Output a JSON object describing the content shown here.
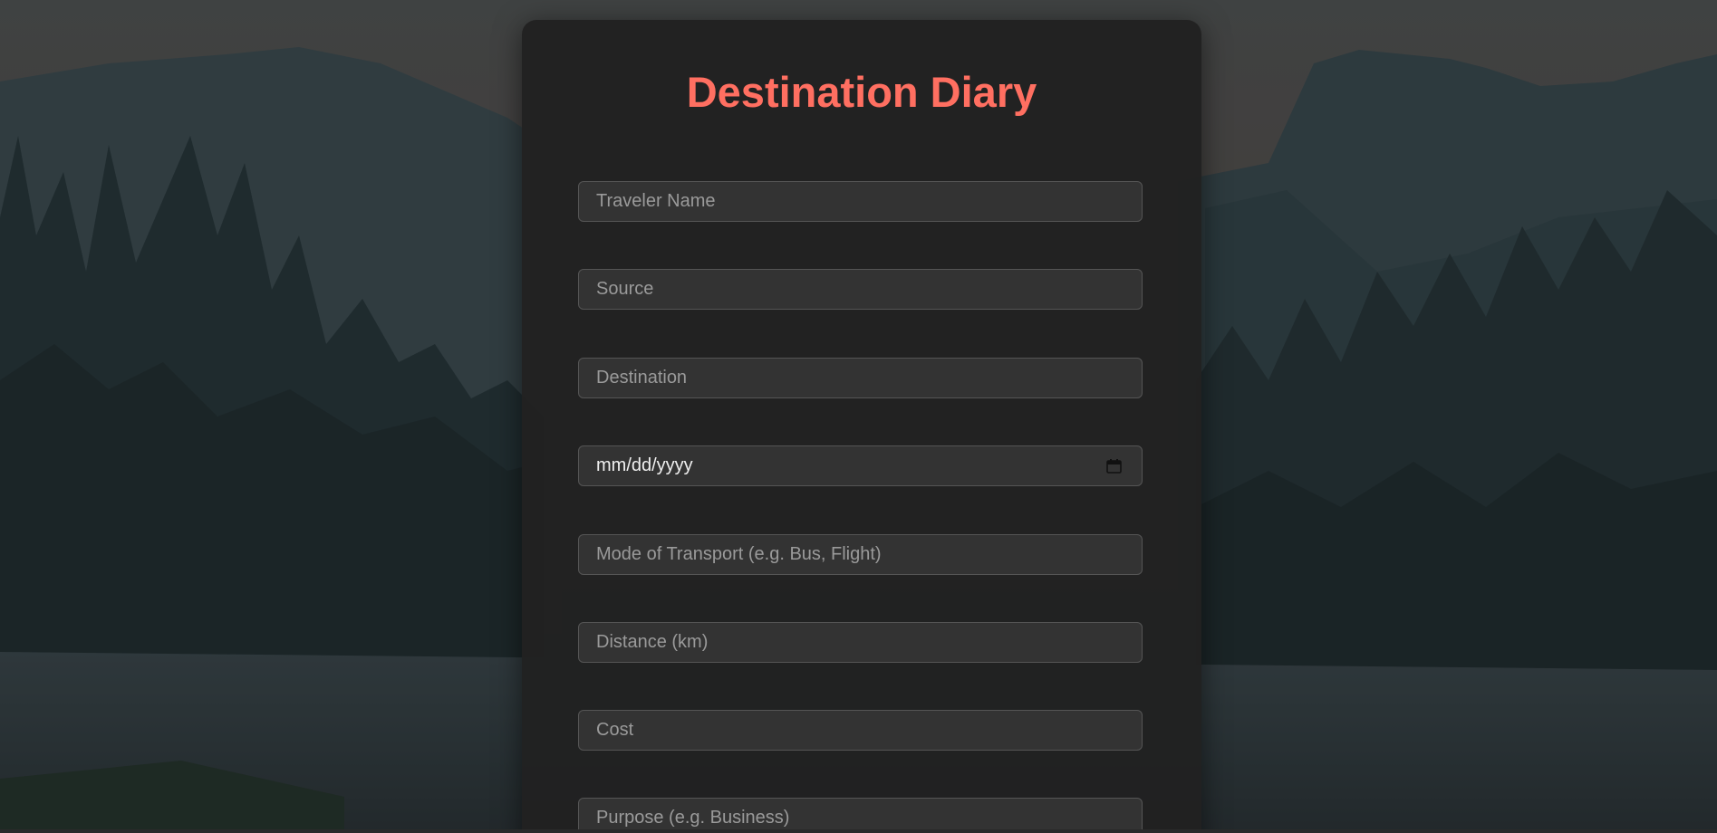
{
  "app": {
    "title": "Destination Diary"
  },
  "form": {
    "fields": [
      {
        "name": "traveler-name-input",
        "placeholder": "Traveler Name",
        "value": ""
      },
      {
        "name": "source-input",
        "placeholder": "Source",
        "value": ""
      },
      {
        "name": "destination-input",
        "placeholder": "Destination",
        "value": ""
      },
      {
        "name": "date-input",
        "placeholder": "mm/dd/yyyy",
        "value": ""
      },
      {
        "name": "transport-mode-input",
        "placeholder": "Mode of Transport (e.g. Bus, Flight)",
        "value": ""
      },
      {
        "name": "distance-input",
        "placeholder": "Distance (km)",
        "value": ""
      },
      {
        "name": "cost-input",
        "placeholder": "Cost",
        "value": ""
      },
      {
        "name": "purpose-input",
        "placeholder": "Purpose (e.g. Business)",
        "value": ""
      }
    ]
  },
  "colors": {
    "accent": "#ff6f61",
    "card": "#212121",
    "field": "#333333"
  },
  "icons": {
    "date_picker": "calendar-icon"
  }
}
